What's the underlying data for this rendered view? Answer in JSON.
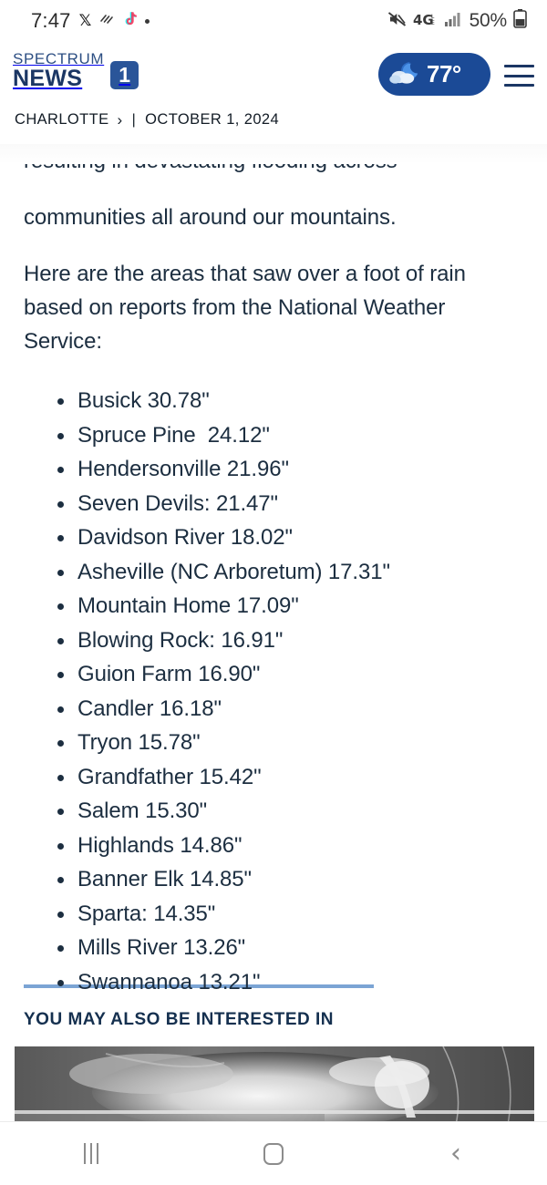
{
  "status_bar": {
    "time": "7:47",
    "left_icons": [
      "x-logo-icon",
      "notification-squiggle-icon",
      "tiktok-icon",
      "dot-icon"
    ],
    "right_icons": [
      "mute-icon",
      "network-4g-lte-icon",
      "signal-bars-icon"
    ],
    "battery_percent": "50%",
    "network_label": "4G",
    "network_sub": "LTE"
  },
  "header": {
    "brand_spectrum": "SPECTRUM",
    "brand_news": "NEWS",
    "brand_badge": "1",
    "weather_temp": "77°",
    "weather_icon": "night-cloud-icon",
    "menu_icon": "hamburger-menu-icon",
    "breadcrumb": {
      "location": "CHARLOTTE",
      "chevron": "›",
      "separator": "|",
      "date": "OCTOBER 1, 2024"
    }
  },
  "article": {
    "paragraph_clipped": "resulting in devastating flooding across",
    "paragraph_1": "communities all around our mountains.",
    "paragraph_2": "Here are the areas that saw over a foot of rain based on reports from the National Weather Service:",
    "rain_items": [
      "Busick 30.78\"",
      "Spruce Pine  24.12\"",
      "Hendersonville 21.96\"",
      "Seven Devils: 21.47\"",
      "Davidson River 18.02\"",
      "Asheville (NC Arboretum) 17.31\"",
      "Mountain Home 17.09\"",
      "Blowing Rock: 16.91\"",
      "Guion Farm 16.90\"",
      "Candler 16.18\"",
      "Tryon 15.78\"",
      "Grandfather 15.42\"",
      "Salem 15.30\"",
      "Highlands 14.86\"",
      "Banner Elk 14.85\"",
      "Sparta: 14.35\"",
      "Mills River 13.26\"",
      "Swannanoa 13.21\""
    ]
  },
  "related": {
    "title": "YOU MAY ALSO BE INTERESTED IN",
    "thumbnail_alt": "grayscale-satellite-radar-image"
  },
  "nav_bar": {
    "recents_label": "recents-icon",
    "home_label": "home-icon",
    "back_label": "back-icon",
    "back_glyph": "‹"
  },
  "colors": {
    "brand_navy": "#1b3664",
    "brand_blue": "#2a5599",
    "weather_pill": "#1b4a96",
    "body_text": "#1c2e40",
    "divider_blue": "#7ba4d4",
    "related_title": "#15304f"
  }
}
